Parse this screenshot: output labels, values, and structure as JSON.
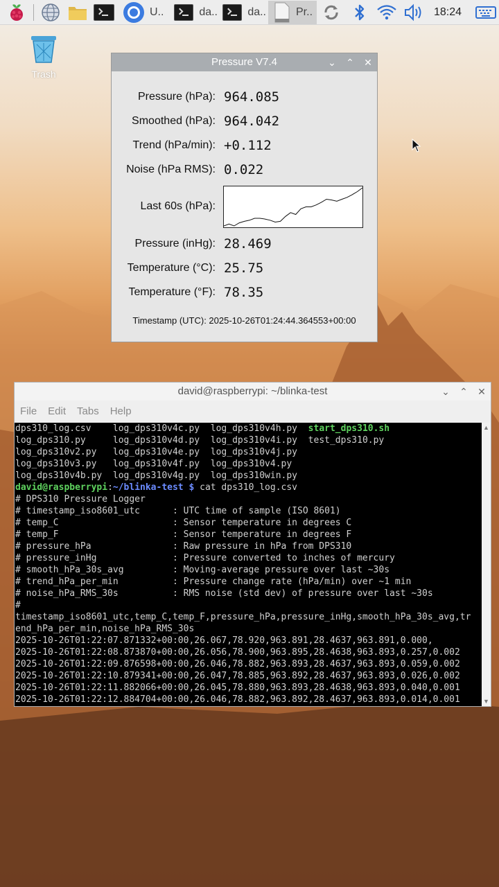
{
  "taskbar": {
    "tasks": [
      {
        "label": "U..",
        "icon": "chromium-icon"
      },
      {
        "label": "da..",
        "icon": "terminal-icon"
      },
      {
        "label": "da..",
        "icon": "terminal-icon"
      },
      {
        "label": "Pr..",
        "icon": "window-icon"
      }
    ],
    "clock": "18:24"
  },
  "desktop": {
    "trash_label": "Trash"
  },
  "pressure_window": {
    "title": "Pressure V7.4",
    "rows": [
      {
        "label": "Pressure (hPa):",
        "value": "964.085"
      },
      {
        "label": "Smoothed (hPa):",
        "value": "964.042"
      },
      {
        "label": "Trend (hPa/min):",
        "value": "+0.112"
      },
      {
        "label": "Noise (hPa RMS):",
        "value": "0.022"
      },
      {
        "label": "Last 60s (hPa):"
      },
      {
        "label": "Pressure (inHg):",
        "value": "28.469"
      },
      {
        "label": "Temperature (°C):",
        "value": "25.75"
      },
      {
        "label": "Temperature (°F):",
        "value": "78.35"
      }
    ],
    "timestamp": "Timestamp (UTC): 2025-10-26T01:24:44.364553+00:00",
    "sparkline": [
      0.0,
      0.05,
      0.0,
      0.08,
      0.12,
      0.15,
      0.2,
      0.2,
      0.18,
      0.15,
      0.1,
      0.12,
      0.25,
      0.35,
      0.3,
      0.45,
      0.5,
      0.5,
      0.55,
      0.62,
      0.7,
      0.68,
      0.65,
      0.7,
      0.75,
      0.82,
      0.9,
      1.0
    ]
  },
  "terminal": {
    "title": "david@raspberrypi: ~/blinka-test",
    "menu": [
      "File",
      "Edit",
      "Tabs",
      "Help"
    ],
    "listing": [
      [
        "dps310_log.csv",
        "log_dps310v4c.py",
        "log_dps310v4h.py",
        "start_dps310.sh"
      ],
      [
        "log_dps310.py",
        "log_dps310v4d.py",
        "log_dps310v4i.py",
        "test_dps310.py"
      ],
      [
        "log_dps310v2.py",
        "log_dps310v4e.py",
        "log_dps310v4j.py",
        ""
      ],
      [
        "log_dps310v3.py",
        "log_dps310v4f.py",
        "log_dps310v4.py",
        ""
      ],
      [
        "log_dps310v4b.py",
        "log_dps310v4g.py",
        "log_dps310win.py",
        ""
      ]
    ],
    "prompt_user": "david@raspberrypi",
    "prompt_sep": ":",
    "prompt_path": "~/blinka-test $",
    "prompt_cmd": " cat dps310_log.csv",
    "output": [
      "# DPS310 Pressure Logger",
      "# timestamp_iso8601_utc      : UTC time of sample (ISO 8601)",
      "# temp_C                     : Sensor temperature in degrees C",
      "# temp_F                     : Sensor temperature in degrees F",
      "# pressure_hPa               : Raw pressure in hPa from DPS310",
      "# pressure_inHg              : Pressure converted to inches of mercury",
      "# smooth_hPa_30s_avg         : Moving-average pressure over last ~30s",
      "# trend_hPa_per_min          : Pressure change rate (hPa/min) over ~1 min",
      "# noise_hPa_RMS_30s          : RMS noise (std dev) of pressure over last ~30s",
      "#",
      "timestamp_iso8601_utc,temp_C,temp_F,pressure_hPa,pressure_inHg,smooth_hPa_30s_avg,tr",
      "end_hPa_per_min,noise_hPa_RMS_30s",
      "2025-10-26T01:22:07.871332+00:00,26.067,78.920,963.891,28.4637,963.891,0.000,",
      "2025-10-26T01:22:08.873870+00:00,26.056,78.900,963.895,28.4638,963.893,0.257,0.002",
      "2025-10-26T01:22:09.876598+00:00,26.046,78.882,963.893,28.4637,963.893,0.059,0.002",
      "2025-10-26T01:22:10.879341+00:00,26.047,78.885,963.892,28.4637,963.893,0.026,0.002",
      "2025-10-26T01:22:11.882066+00:00,26.045,78.880,963.893,28.4638,963.893,0.040,0.001",
      "2025-10-26T01:22:12.884704+00:00,26.046,78.882,963.892,28.4637,963.893,0.014,0.001"
    ]
  }
}
